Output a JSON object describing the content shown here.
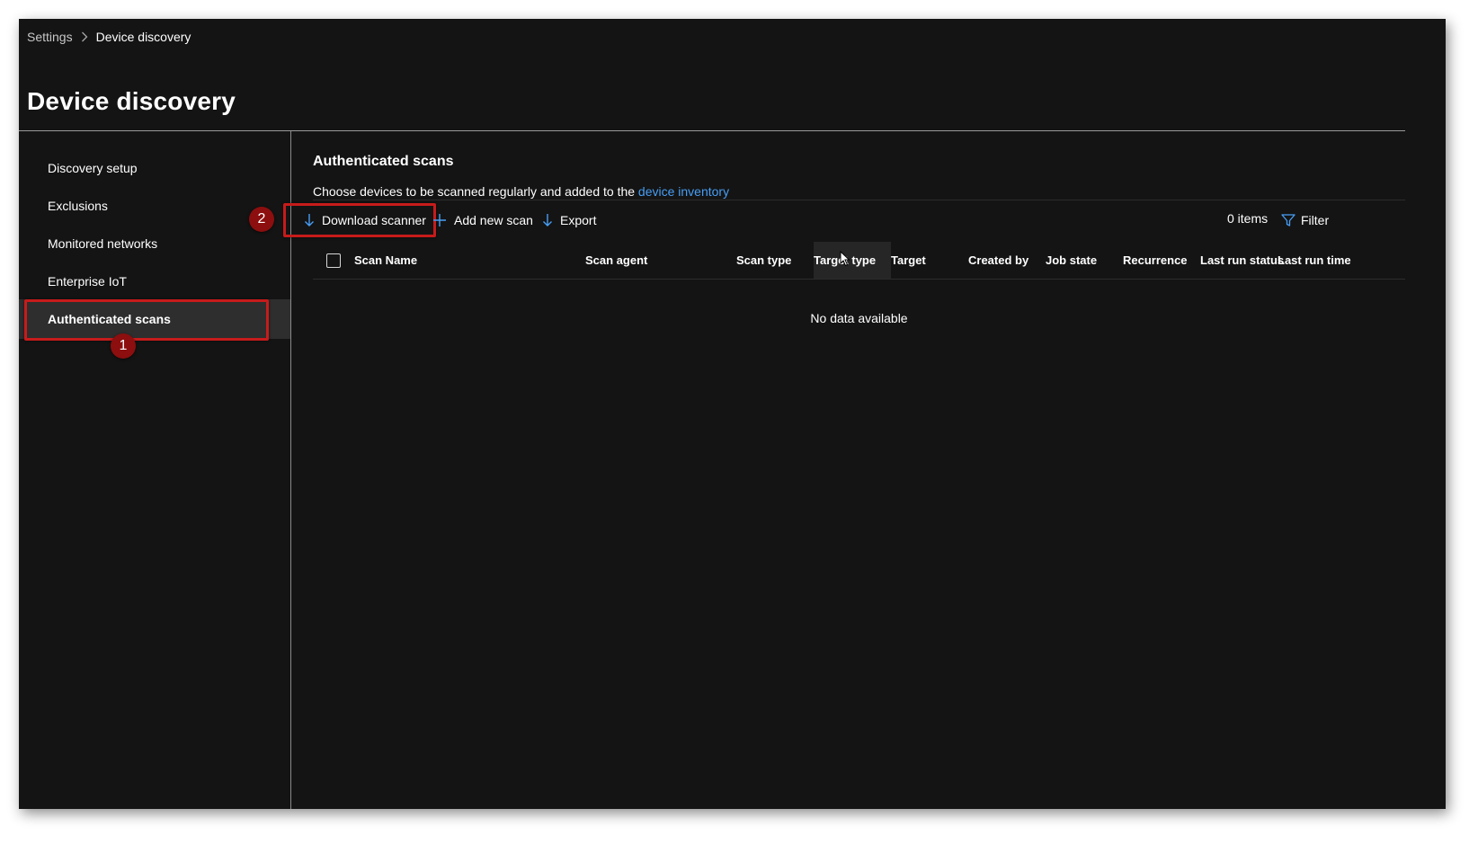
{
  "breadcrumb": {
    "parent": "Settings",
    "current": "Device discovery"
  },
  "page_title": "Device discovery",
  "sidebar": {
    "items": [
      {
        "label": "Discovery setup"
      },
      {
        "label": "Exclusions"
      },
      {
        "label": "Monitored networks"
      },
      {
        "label": "Enterprise IoT"
      },
      {
        "label": "Authenticated scans",
        "selected": true
      }
    ]
  },
  "annotations": {
    "step1": "1",
    "step2": "2",
    "highlight_color": "#c71b1b",
    "badge_color": "#8c0e0e"
  },
  "main": {
    "section_title": "Authenticated scans",
    "description_prefix": "Choose devices to be scanned regularly and added to the ",
    "description_link": "device inventory",
    "link_color": "#479ef5"
  },
  "toolbar": {
    "download_label": "Download scanner",
    "download_icon": "arrow-down-icon",
    "add_label": "Add new scan",
    "add_icon": "plus-icon",
    "export_label": "Export",
    "export_icon": "arrow-down-icon",
    "items_count": "0 items",
    "filter_label": "Filter",
    "filter_icon": "funnel-icon"
  },
  "table": {
    "columns": [
      "Scan Name",
      "Scan agent",
      "Scan type",
      "Target type",
      "Target",
      "Created by",
      "Job state",
      "Recurrence",
      "Last run status",
      "Last run time"
    ],
    "empty_text": "No data available"
  }
}
